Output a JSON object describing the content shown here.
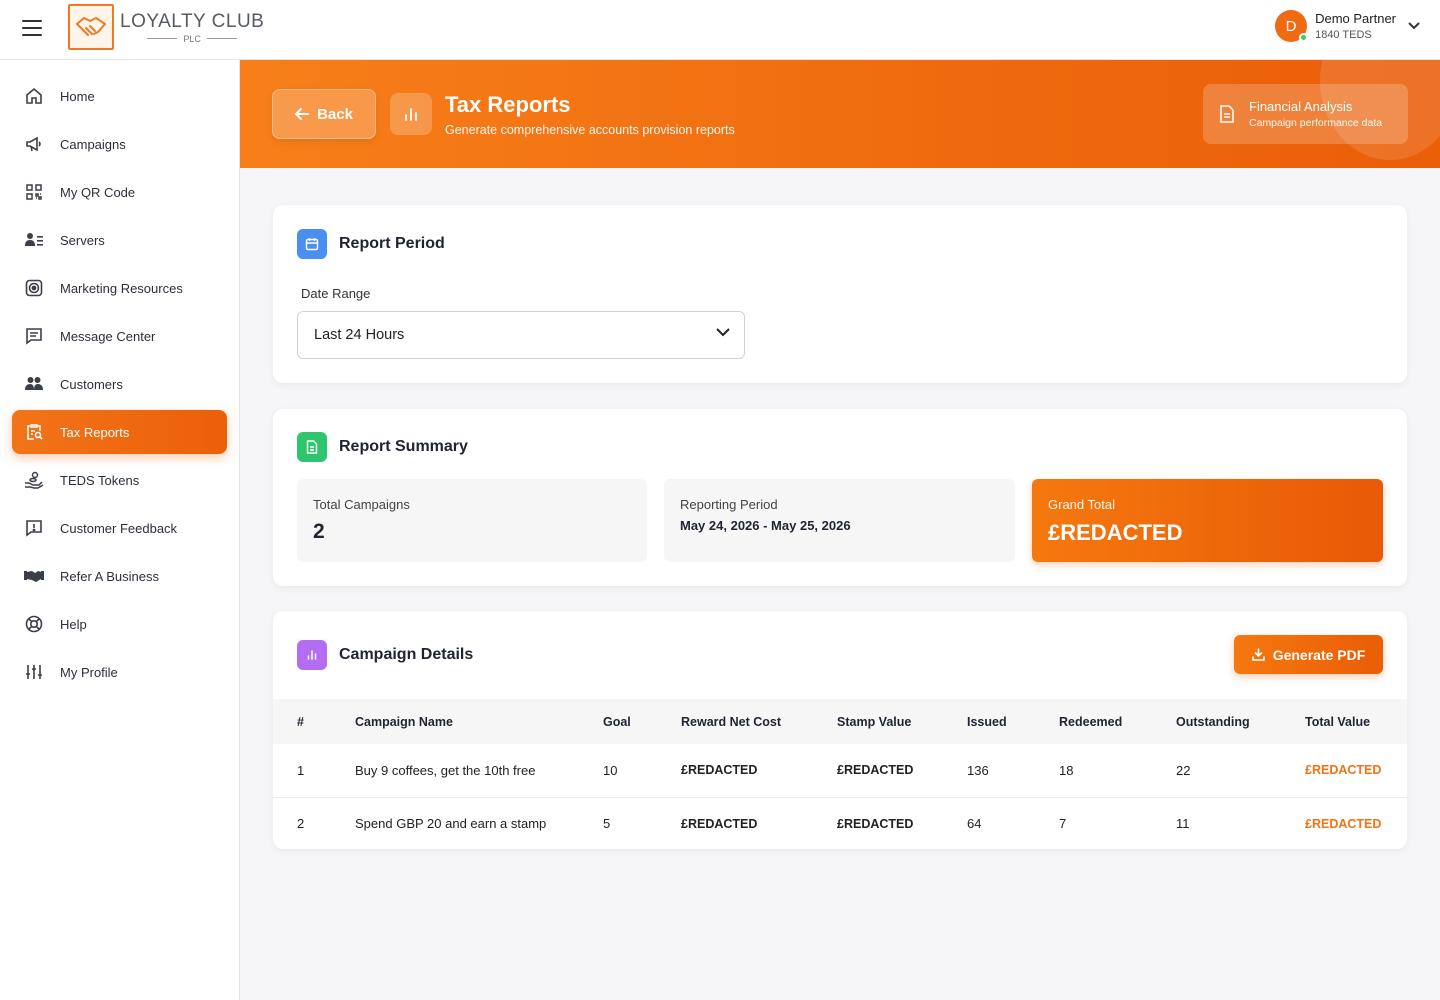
{
  "brand": {
    "name": "LOYALTY CLUB",
    "sub": "PLC",
    "accent": "#f07315"
  },
  "user": {
    "initial": "D",
    "name": "Demo Partner",
    "sub": "1840 TEDS"
  },
  "sidebar": {
    "items": [
      {
        "label": "Home",
        "icon": "home-icon"
      },
      {
        "label": "Campaigns",
        "icon": "megaphone-icon"
      },
      {
        "label": "My QR Code",
        "icon": "qr-code-icon"
      },
      {
        "label": "Servers",
        "icon": "servers-icon"
      },
      {
        "label": "Marketing Resources",
        "icon": "target-icon"
      },
      {
        "label": "Message Center",
        "icon": "message-icon"
      },
      {
        "label": "Customers",
        "icon": "customers-icon"
      },
      {
        "label": "Tax Reports",
        "icon": "clipboard-search-icon",
        "active": true
      },
      {
        "label": "TEDS Tokens",
        "icon": "tokens-icon"
      },
      {
        "label": "Customer Feedback",
        "icon": "feedback-icon"
      },
      {
        "label": "Refer A Business",
        "icon": "handshake-icon"
      },
      {
        "label": "Help",
        "icon": "lifebuoy-icon"
      },
      {
        "label": "My Profile",
        "icon": "sliders-icon"
      }
    ]
  },
  "header": {
    "back_label": "Back",
    "title": "Tax Reports",
    "subtitle": "Generate comprehensive accounts provision reports",
    "fin_title": "Financial Analysis",
    "fin_sub": "Campaign performance data"
  },
  "period": {
    "title": "Report Period",
    "date_label": "Date Range",
    "selected": "Last 24 Hours"
  },
  "summary": {
    "title": "Report Summary",
    "total_campaigns_label": "Total Campaigns",
    "total_campaigns": "2",
    "reporting_period_label": "Reporting Period",
    "reporting_period": "May 24, 2026 - May 25, 2026",
    "grand_total_label": "Grand Total",
    "grand_total": "£REDACTED"
  },
  "details": {
    "title": "Campaign Details",
    "pdf_label": "Generate PDF",
    "columns": [
      "#",
      "Campaign Name",
      "Goal",
      "Reward Net Cost",
      "Stamp Value",
      "Issued",
      "Redeemed",
      "Outstanding",
      "Total Value"
    ],
    "rows": [
      [
        "1",
        "Buy 9 coffees, get the 10th free",
        "10",
        "£REDACTED",
        "£REDACTED",
        "136",
        "18",
        "22",
        "£REDACTED"
      ],
      [
        "2",
        "Spend GBP 20 and earn a stamp",
        "5",
        "£REDACTED",
        "£REDACTED",
        "64",
        "7",
        "11",
        "£REDACTED"
      ]
    ]
  }
}
